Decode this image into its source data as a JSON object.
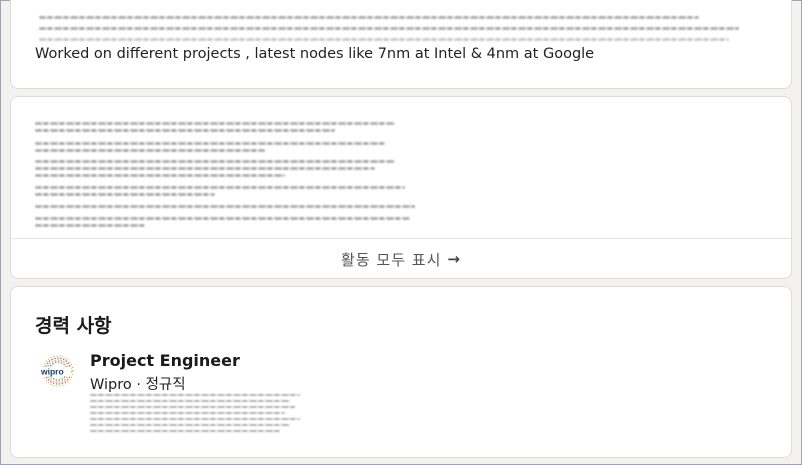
{
  "about": {
    "text": "Worked on different projects , latest nodes like 7nm at Intel & 4nm at Google"
  },
  "activity": {
    "show_all_label": "활동 모두 표시",
    "show_all_arrow": "→"
  },
  "experience": {
    "title": "경력 사항",
    "items": [
      {
        "logo_text": "wipro",
        "title": "Project Engineer",
        "company_line": "Wipro · 정규직"
      }
    ]
  }
}
